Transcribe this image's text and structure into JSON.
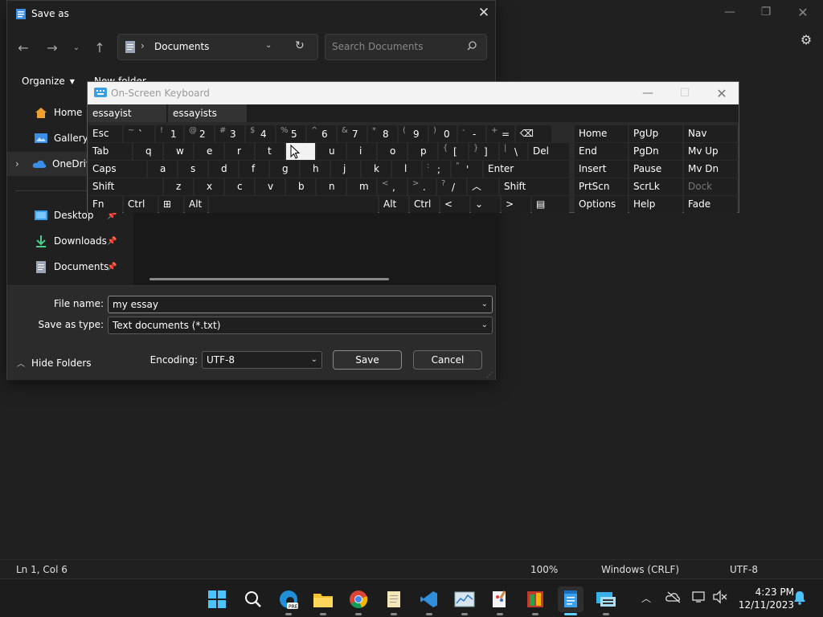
{
  "background_app": {
    "status": {
      "position": "Ln 1, Col 6",
      "zoom": "100%",
      "line_ending": "Windows (CRLF)",
      "encoding": "UTF-8"
    }
  },
  "dialog": {
    "title": "Save as",
    "address": {
      "folder": "Documents"
    },
    "search": {
      "placeholder": "Search Documents"
    },
    "toolbar": {
      "organize": "Organize",
      "new_folder": "New folder"
    },
    "nav": [
      {
        "label": "Home"
      },
      {
        "label": "Gallery"
      },
      {
        "label": "OneDrive"
      },
      {
        "label": "Desktop"
      },
      {
        "label": "Downloads"
      },
      {
        "label": "Documents"
      }
    ],
    "file_name_label": "File name:",
    "file_name": "my essay",
    "save_type_label": "Save as type:",
    "save_type": "Text documents (*.txt)",
    "hide_folders": "Hide Folders",
    "encoding_label": "Encoding:",
    "encoding": "UTF-8",
    "save": "Save",
    "cancel": "Cancel"
  },
  "osk": {
    "title": "On-Screen Keyboard",
    "predictions": [
      "essayist",
      "essayists"
    ]
  },
  "taskbar": {
    "time": "4:23 PM",
    "date": "12/11/2023"
  }
}
